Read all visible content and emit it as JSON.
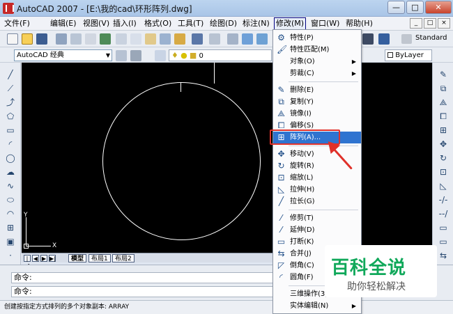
{
  "window": {
    "title": "AutoCAD 2007 - [E:\\我的cad\\环形阵列.dwg]",
    "minimize": "—",
    "maximize": "□",
    "close": "✕"
  },
  "menubar": {
    "items": [
      "文件(F)",
      "编辑(E)",
      "视图(V)",
      "插入(I)",
      "格式(O)",
      "工具(T)",
      "绘图(D)",
      "标注(N)",
      "修改(M)",
      "窗口(W)",
      "帮助(H)"
    ],
    "active": "修改(M)",
    "doc_buttons": [
      "_",
      "□",
      "×"
    ]
  },
  "toolbar": {
    "workspace": "AutoCAD 经典",
    "layer_value": "0",
    "bylayer": "ByLayer",
    "text_style": "Standard"
  },
  "canvas": {
    "ucs_x": "X",
    "ucs_y": "Y"
  },
  "layout_tabs": [
    "模型",
    "布局1",
    "布局2"
  ],
  "command": {
    "line1": "命令:",
    "line2": "命令:"
  },
  "status": "创建按指定方式排列的多个对象副本:  ARRAY",
  "modify_menu": [
    {
      "label": "特性(P)",
      "icon": "properties-icon",
      "sub": false
    },
    {
      "label": "特性匹配(M)",
      "icon": "match-properties-icon",
      "sub": false
    },
    {
      "label": "对象(O)",
      "icon": "",
      "sub": true
    },
    {
      "label": "剪裁(C)",
      "icon": "",
      "sub": true
    },
    {
      "label": "删除(E)",
      "icon": "erase-icon",
      "sub": false
    },
    {
      "label": "复制(Y)",
      "icon": "copy-icon",
      "sub": false
    },
    {
      "label": "镜像(I)",
      "icon": "mirror-icon",
      "sub": false
    },
    {
      "label": "偏移(S)",
      "icon": "offset-icon",
      "sub": false
    },
    {
      "label": "阵列(A)...",
      "icon": "array-icon",
      "sub": false,
      "selected": true
    },
    {
      "label": "移动(V)",
      "icon": "move-icon",
      "sub": false
    },
    {
      "label": "旋转(R)",
      "icon": "rotate-icon",
      "sub": false
    },
    {
      "label": "缩放(L)",
      "icon": "scale-icon",
      "sub": false
    },
    {
      "label": "拉伸(H)",
      "icon": "stretch-icon",
      "sub": false
    },
    {
      "label": "拉长(G)",
      "icon": "lengthen-icon",
      "sub": false
    },
    {
      "label": "修剪(T)",
      "icon": "trim-icon",
      "sub": false
    },
    {
      "label": "延伸(D)",
      "icon": "extend-icon",
      "sub": false
    },
    {
      "label": "打断(K)",
      "icon": "break-icon",
      "sub": false
    },
    {
      "label": "合并(J)",
      "icon": "join-icon",
      "sub": false
    },
    {
      "label": "倒角(C)",
      "icon": "chamfer-icon",
      "sub": false
    },
    {
      "label": "圆角(F)",
      "icon": "fillet-icon",
      "sub": false
    },
    {
      "label": "三维操作(3)",
      "icon": "",
      "sub": true
    },
    {
      "label": "实体编辑(N)",
      "icon": "",
      "sub": true
    }
  ],
  "watermark": {
    "logo": "百科全说",
    "sub": "助你轻松解决"
  }
}
